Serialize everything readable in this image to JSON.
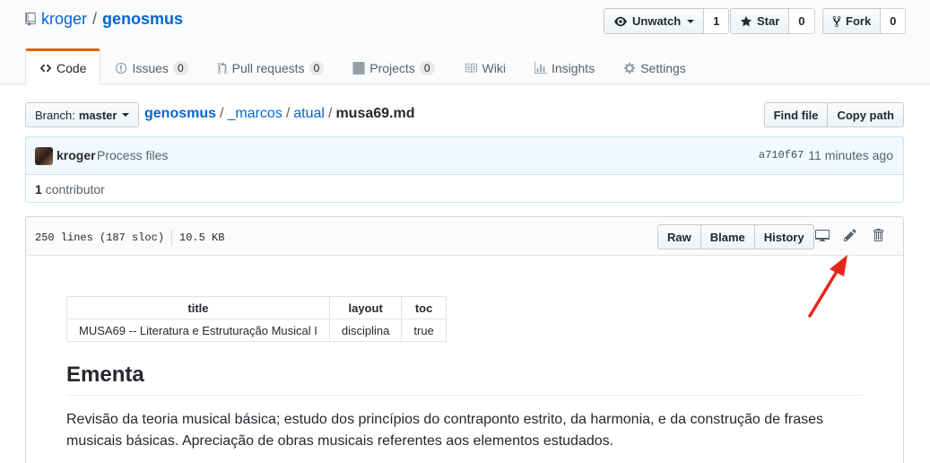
{
  "repo": {
    "owner": "kroger",
    "separator": "/",
    "name": "genosmus"
  },
  "actions": {
    "watch_label": "Unwatch",
    "watch_count": "1",
    "star_label": "Star",
    "star_count": "0",
    "fork_label": "Fork",
    "fork_count": "0"
  },
  "tabs": [
    {
      "label": "Code"
    },
    {
      "label": "Issues",
      "count": "0"
    },
    {
      "label": "Pull requests",
      "count": "0"
    },
    {
      "label": "Projects",
      "count": "0"
    },
    {
      "label": "Wiki"
    },
    {
      "label": "Insights"
    },
    {
      "label": "Settings"
    }
  ],
  "branch": {
    "prefix": "Branch:",
    "name": "master"
  },
  "breadcrumb": {
    "root": "genosmus",
    "parts": [
      "_marcos",
      "atual"
    ],
    "sep": "/",
    "file": "musa69.md"
  },
  "file_nav": {
    "find_file": "Find file",
    "copy_path": "Copy path"
  },
  "commit": {
    "author": "kroger",
    "message": "Process files",
    "sha": "a710f67",
    "time": "11 minutes ago"
  },
  "contributors": {
    "count": "1",
    "label": "contributor"
  },
  "file": {
    "lines": "250 lines (187 sloc)",
    "size": "10.5 KB",
    "raw": "Raw",
    "blame": "Blame",
    "history": "History"
  },
  "front_matter": {
    "headers": [
      "title",
      "layout",
      "toc"
    ],
    "row": [
      "MUSA69 -- Literatura e Estruturação Musical I",
      "disciplina",
      "true"
    ]
  },
  "content": {
    "heading": "Ementa",
    "paragraph": "Revisão da teoria musical básica; estudo dos princípios do contraponto estrito, da harmonia, e da construção de frases musicais básicas. Apreciação de obras musicais referentes aos elementos estudados."
  },
  "colors": {
    "link": "#0366d6",
    "tab_accent": "#e36209",
    "commit_bg": "#f1f8ff",
    "annotation_arrow": "#e8251b"
  }
}
